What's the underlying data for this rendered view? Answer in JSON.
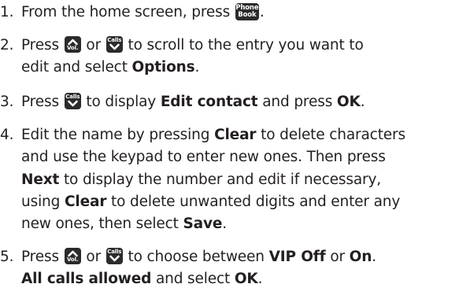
{
  "steps": [
    {
      "number": "1.",
      "t1": "From the home screen, press",
      "t2": "."
    },
    {
      "number": "2.",
      "t1": "Press",
      "or": "or",
      "t2": "to scroll to the entry you want to",
      "t3": "edit and select",
      "b1": "Options",
      "t4": "."
    },
    {
      "number": "3.",
      "t1": "Press",
      "t2": "to display",
      "b1": "Edit contact",
      "t3": "and press",
      "b2": "OK",
      "t4": "."
    },
    {
      "number": "4.",
      "t1": "Edit the name by pressing",
      "b1": "Clear",
      "t2": "to delete characters",
      "t3": "and use the keypad to enter new ones. Then press",
      "b2": "Next",
      "t4": "to display the number and edit if necessary,",
      "t5": "using",
      "b3": "Clear",
      "t6": "to delete unwanted digits and enter any",
      "t7": "new ones, then select",
      "b4": "Save",
      "t8": "."
    },
    {
      "number": "5.",
      "t1": "Press",
      "or": "or",
      "t2": "to choose between",
      "b1": "VIP Off",
      "t3": "or",
      "b2": "On",
      "t4": ".",
      "b3": "All calls allowed",
      "t5": "and select",
      "b4": "OK",
      "t6": "."
    }
  ],
  "keys": {
    "phone_book": {
      "line1": "Phone",
      "line2": "Book",
      "icon": "phone-book-key-icon"
    },
    "vol_up": {
      "label": "Vol.",
      "icon": "vol-up-key-icon"
    },
    "calls_down": {
      "label": "Calls",
      "icon": "calls-down-key-icon"
    }
  },
  "colors": {
    "text": "#231f20",
    "key_background": "#2b2b2b",
    "key_foreground": "#ffffff"
  }
}
